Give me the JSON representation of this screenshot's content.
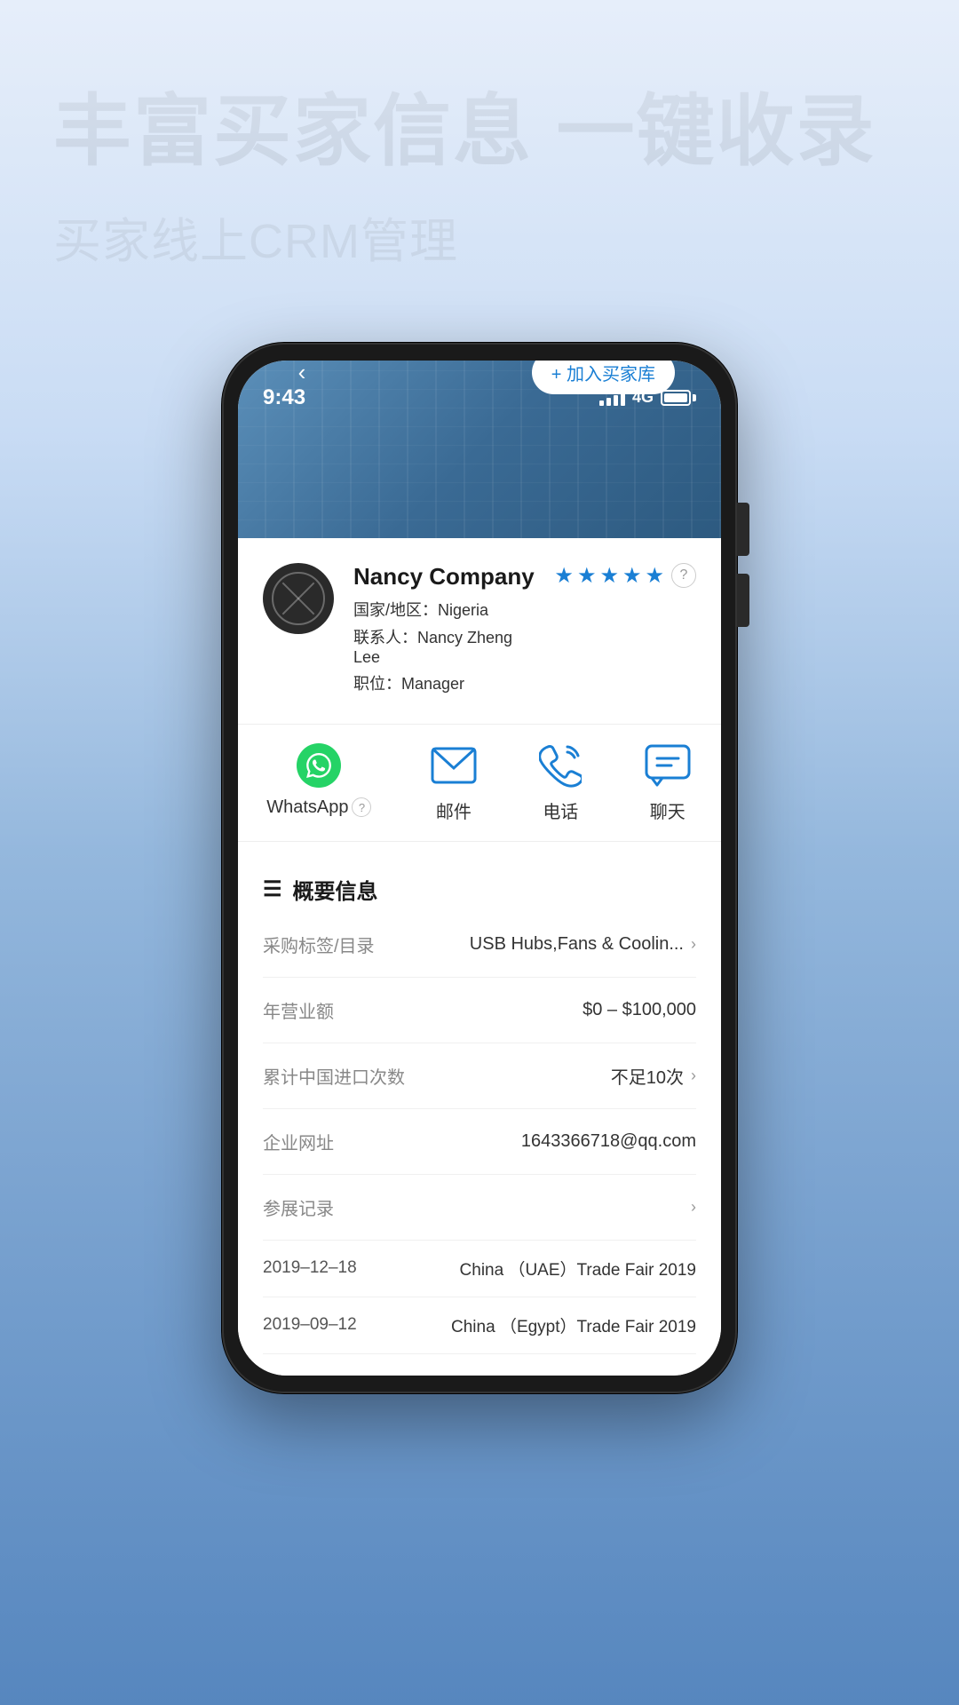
{
  "page": {
    "main_title": "丰富买家信息 一键收录",
    "sub_title": "买家线上CRM管理"
  },
  "phone": {
    "status_bar": {
      "time": "9:43",
      "network": "4G"
    },
    "add_buyer_btn": "+ 加入买家库",
    "company": {
      "name": "Nancy Company",
      "country_label": "国家/地区：",
      "country": "Nigeria",
      "contact_label": "联系人：",
      "contact": "Nancy Zheng Lee",
      "position_label": "职位：",
      "position": "Manager",
      "rating": 4.5
    },
    "actions": [
      {
        "id": "whatsapp",
        "label": "WhatsApp",
        "has_help": true
      },
      {
        "id": "email",
        "label": "邮件",
        "has_help": false
      },
      {
        "id": "phone",
        "label": "电话",
        "has_help": false
      },
      {
        "id": "chat",
        "label": "聊天",
        "has_help": false
      }
    ],
    "overview": {
      "title": "概要信息",
      "rows": [
        {
          "label": "采购标签/目录",
          "value": "USB Hubs,Fans & Coolin...",
          "has_chevron": true
        },
        {
          "label": "年营业额",
          "value": "$0 – $100,000",
          "has_chevron": false
        },
        {
          "label": "累计中国进口次数",
          "value": "不足10次",
          "has_chevron": true
        },
        {
          "label": "企业网址",
          "value": "1643366718@qq.com",
          "has_chevron": false
        },
        {
          "label": "参展记录",
          "value": "",
          "has_chevron": true
        }
      ],
      "trade_fairs": [
        {
          "date": "2019–12–18",
          "name": "China （UAE）Trade Fair 2019"
        },
        {
          "date": "2019–09–12",
          "name": "China （Egypt）Trade Fair 2019"
        }
      ]
    }
  }
}
